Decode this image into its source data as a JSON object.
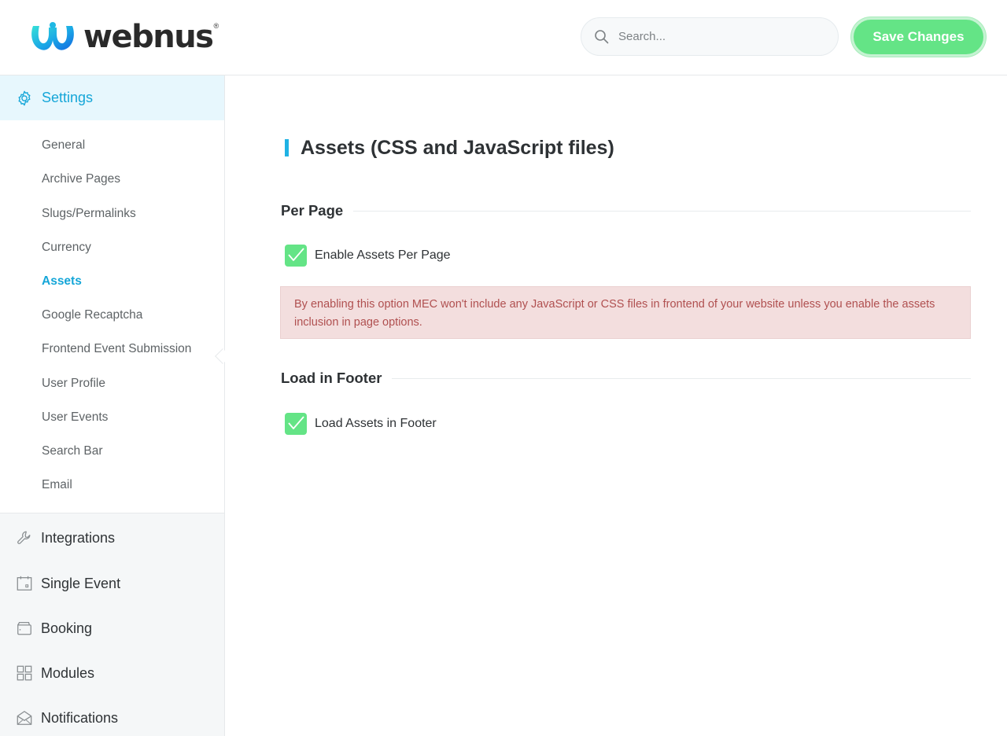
{
  "brand": {
    "name": "webnus",
    "reg": "®",
    "gradient_start": "#2fd6e3",
    "gradient_end": "#1b7fe8"
  },
  "header": {
    "search_placeholder": "Search...",
    "save_label": "Save Changes",
    "save_color": "#64e486"
  },
  "sidebar": {
    "active_section": {
      "label": "Settings",
      "icon": "gear-icon",
      "color": "#15a6d8"
    },
    "submenu": [
      {
        "label": "General",
        "active": false
      },
      {
        "label": "Archive Pages",
        "active": false
      },
      {
        "label": "Slugs/Permalinks",
        "active": false
      },
      {
        "label": "Currency",
        "active": false
      },
      {
        "label": "Assets",
        "active": true
      },
      {
        "label": "Google Recaptcha",
        "active": false
      },
      {
        "label": "Frontend Event Submission",
        "active": false
      },
      {
        "label": "User Profile",
        "active": false
      },
      {
        "label": "User Events",
        "active": false
      },
      {
        "label": "Search Bar",
        "active": false
      },
      {
        "label": "Email",
        "active": false
      }
    ],
    "sections": [
      {
        "label": "Integrations",
        "icon": "wrench-icon"
      },
      {
        "label": "Single Event",
        "icon": "calendar-icon"
      },
      {
        "label": "Booking",
        "icon": "wallet-icon"
      },
      {
        "label": "Modules",
        "icon": "grid-icon"
      },
      {
        "label": "Notifications",
        "icon": "envelope-icon"
      }
    ]
  },
  "main": {
    "title": "Assets (CSS and JavaScript files)",
    "sections": [
      {
        "heading": "Per Page",
        "checkbox_label": "Enable Assets Per Page",
        "checked": true,
        "alert": "By enabling this option MEC won't include any JavaScript or CSS files in frontend of your website unless you enable the assets inclusion in page options."
      },
      {
        "heading": "Load in Footer",
        "checkbox_label": "Load Assets in Footer",
        "checked": true
      }
    ]
  }
}
